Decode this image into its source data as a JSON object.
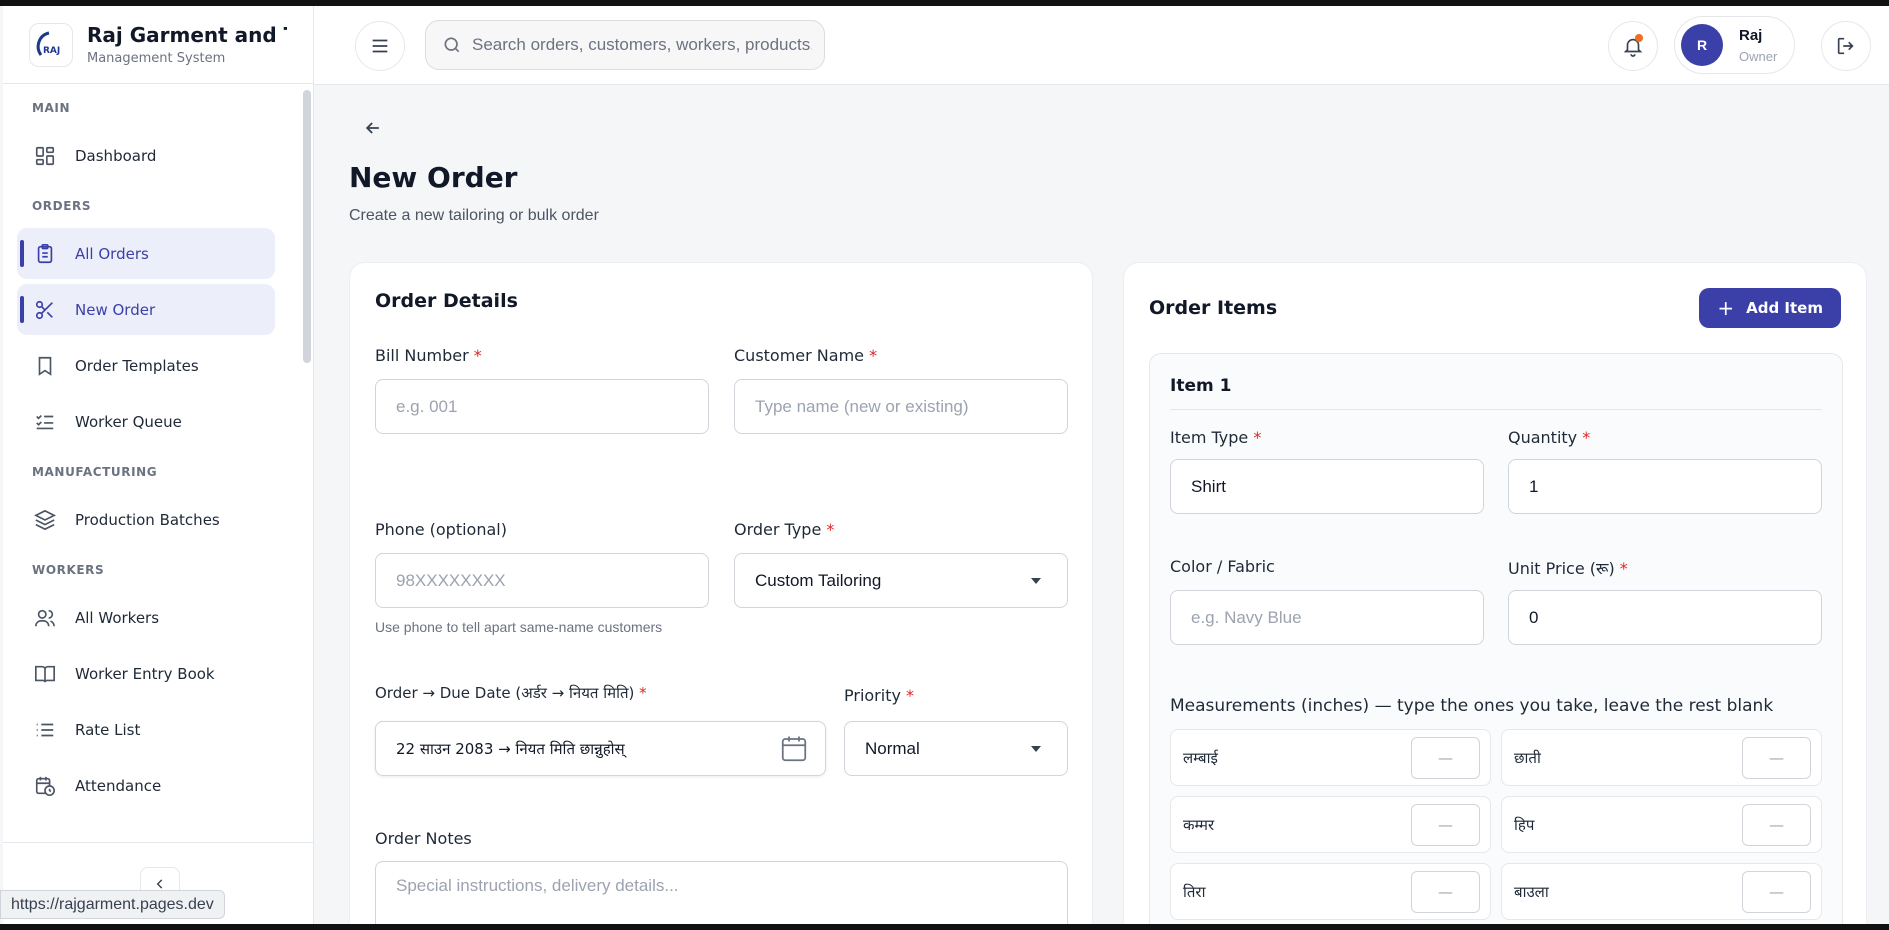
{
  "brand": {
    "title": "Raj Garment and Tailors",
    "subtitle": "Management System",
    "logo_text": "RAJ"
  },
  "header": {
    "search_placeholder": "Search orders, customers, workers, products...",
    "user_initial": "R",
    "user_name": "Raj",
    "user_role": "Owner"
  },
  "sidebar": {
    "sections": {
      "main": "MAIN",
      "orders": "ORDERS",
      "manufacturing": "MANUFACTURING",
      "workers": "WORKERS"
    },
    "items": {
      "dashboard": "Dashboard",
      "all_orders": "All Orders",
      "new_order": "New Order",
      "order_templates": "Order Templates",
      "worker_queue": "Worker Queue",
      "production_batches": "Production Batches",
      "all_workers": "All Workers",
      "worker_entry_book": "Worker Entry Book",
      "rate_list": "Rate List",
      "attendance": "Attendance"
    }
  },
  "page": {
    "title": "New Order",
    "subtitle": "Create a new tailoring or bulk order"
  },
  "order_details": {
    "title": "Order Details",
    "bill_number_label": "Bill Number",
    "bill_number_placeholder": "e.g. 001",
    "customer_name_label": "Customer Name",
    "customer_name_placeholder": "Type name (new or existing)",
    "phone_label": "Phone (optional)",
    "phone_placeholder": "98XXXXXXXX",
    "phone_hint": "Use phone to tell apart same-name customers",
    "order_type_label": "Order Type",
    "order_type_value": "Custom Tailoring",
    "date_label": "Order → Due Date (अर्डर → नियत मिति)",
    "date_value": "22 साउन 2083  →  नियत मिति छान्नुहोस्",
    "priority_label": "Priority",
    "priority_value": "Normal",
    "notes_label": "Order Notes",
    "notes_placeholder": "Special instructions, delivery details..."
  },
  "order_items": {
    "title": "Order Items",
    "add_item_label": "Add Item",
    "item_title": "Item 1",
    "item_type_label": "Item Type",
    "item_type_value": "Shirt",
    "quantity_label": "Quantity",
    "quantity_value": "1",
    "color_label": "Color / Fabric",
    "color_placeholder": "e.g. Navy Blue",
    "unit_price_label": "Unit Price (रू)",
    "unit_price_value": "0",
    "measurements_title": "Measurements (inches) — type the ones you take, leave the rest blank",
    "measurements": [
      {
        "label": "लम्बाई",
        "value": "—"
      },
      {
        "label": "छाती",
        "value": "—"
      },
      {
        "label": "कम्मर",
        "value": "—"
      },
      {
        "label": "हिप",
        "value": "—"
      },
      {
        "label": "तिरा",
        "value": "—"
      },
      {
        "label": "बाउला",
        "value": "—"
      }
    ]
  },
  "required_mark": "*",
  "status_url": "https://rajgarment.pages.dev",
  "colors": {
    "accent": "#3b3fa8",
    "required": "#dc2626",
    "notification_dot": "#ef6c21"
  }
}
